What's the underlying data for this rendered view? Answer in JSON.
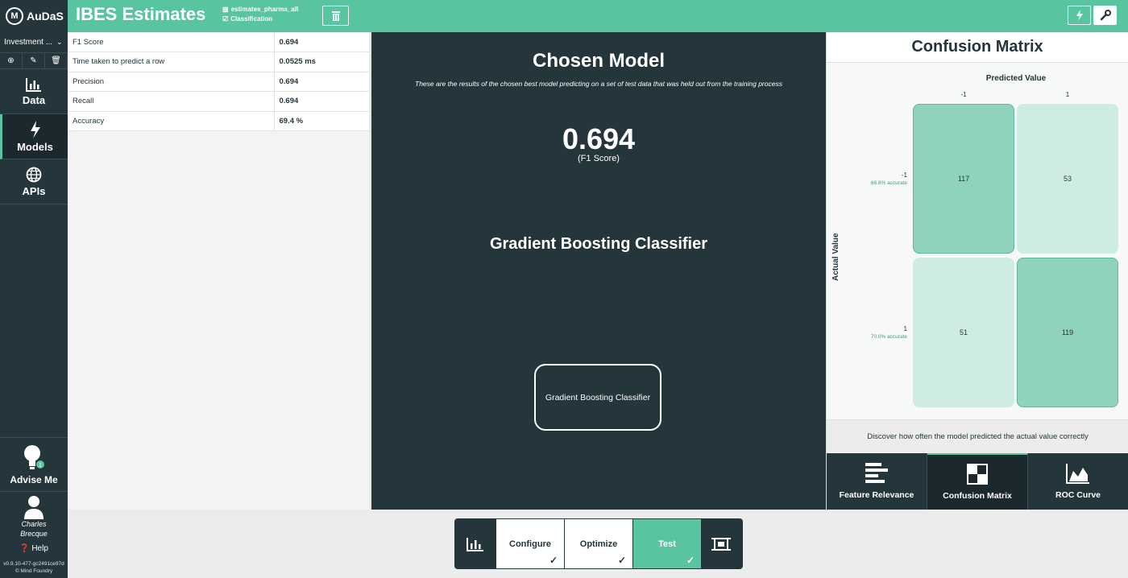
{
  "app": {
    "brand": "AuDaS",
    "project_title": "IBES Estimates",
    "dataset_name": "estimates_pharma_all",
    "task_type": "Classification"
  },
  "sidebar": {
    "workspace": "Investment ...",
    "nav": [
      {
        "label": "Data",
        "icon": "bar-chart-icon"
      },
      {
        "label": "Models",
        "icon": "lightning-icon"
      },
      {
        "label": "APIs",
        "icon": "globe-icon"
      }
    ],
    "advise_label": "Advise Me",
    "advise_badge": "1",
    "user_first": "Charles",
    "user_last": "Brecque",
    "help": "Help",
    "version": "v0.9.10-477-gc2491ce97d",
    "copyright": "© Mind Foundry"
  },
  "metrics": [
    {
      "name": "F1 Score",
      "value": "0.694"
    },
    {
      "name": "Time taken to predict a row",
      "value": "0.0525 ms"
    },
    {
      "name": "Precision",
      "value": "0.694"
    },
    {
      "name": "Recall",
      "value": "0.694"
    },
    {
      "name": "Accuracy",
      "value": "69.4 %"
    }
  ],
  "center": {
    "title": "Chosen Model",
    "subtitle": "These are the results of the chosen best model predicting on a set of test data that was held out from the training process",
    "score": "0.694",
    "score_label": "(F1 Score)",
    "model_name": "Gradient Boosting Classifier",
    "model_button": "Gradient Boosting Classifier"
  },
  "confusion": {
    "title": "Confusion Matrix",
    "x_axis": "Predicted Value",
    "y_axis": "Actual Value",
    "classes": [
      "-1",
      "1"
    ],
    "row_accuracy": [
      "68.8% accurate",
      "70.0% accurate"
    ],
    "matrix": [
      [
        117,
        53
      ],
      [
        51,
        119
      ]
    ],
    "description": "Discover how often the model predicted the actual value correctly",
    "colors": {
      "diag_strong": "#8fd3bc",
      "diag_light": "#cfece2",
      "edge": "#5fb99a"
    }
  },
  "tabs": [
    {
      "label": "Feature Relevance",
      "icon": "feature-bars-icon"
    },
    {
      "label": "Confusion Matrix",
      "icon": "grid-icon"
    },
    {
      "label": "ROC Curve",
      "icon": "area-chart-icon"
    }
  ],
  "stepper": {
    "steps": [
      "Configure",
      "Optimize",
      "Test"
    ]
  }
}
